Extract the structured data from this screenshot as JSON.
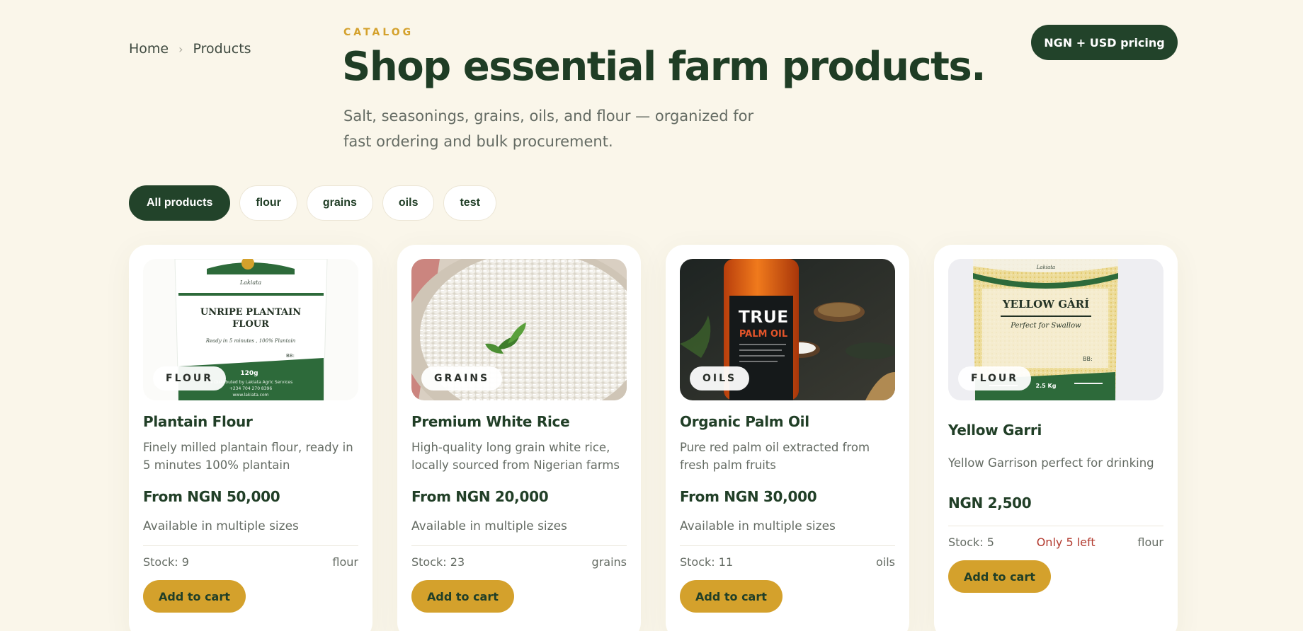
{
  "breadcrumb": {
    "home": "Home",
    "separator": "›",
    "current": "Products"
  },
  "header": {
    "eyebrow": "CATALOG",
    "title": "Shop essential farm products.",
    "subtitle": "Salt, seasonings, grains, oils, and flour — organized for fast ordering and bulk procurement.",
    "pricing_badge": "NGN + USD pricing"
  },
  "filters": [
    "All products",
    "flour",
    "grains",
    "oils",
    "test"
  ],
  "products": [
    {
      "category_badge": "FLOUR",
      "name": "Plantain Flour",
      "description": "Finely milled plantain flour, ready in 5 minutes 100% plantain",
      "price": "From NGN 50,000",
      "sizes": "Available in multiple sizes",
      "stock": "Stock: 9",
      "category": "flour",
      "add_label": "Add to cart",
      "image_text": {
        "brand": "Lakiata",
        "line1": "UNRIPE PLANTAIN",
        "line2": "FLOUR",
        "tagline": "Ready in 5 minutes , 100% Plantain",
        "bb": "BB:",
        "weight": "120g",
        "dist": "% Distributed by Lakiata Agric Services",
        "phone": "+234 704 270 8396",
        "web": "www.lakiata.com"
      }
    },
    {
      "category_badge": "GRAINS",
      "name": "Premium White Rice",
      "description": "High-quality long grain white rice, locally sourced from Nigerian farms",
      "price": "From NGN 20,000",
      "sizes": "Available in multiple sizes",
      "stock": "Stock: 23",
      "category": "grains",
      "add_label": "Add to cart"
    },
    {
      "category_badge": "OILS",
      "name": "Organic Palm Oil",
      "description": "Pure red palm oil extracted from fresh palm fruits",
      "price": "From NGN 30,000",
      "sizes": "Available in multiple sizes",
      "stock": "Stock: 11",
      "category": "oils",
      "add_label": "Add to cart",
      "image_text": {
        "line1": "TRUE",
        "line2": "PALM OIL"
      }
    },
    {
      "category_badge": "FLOUR",
      "name": "Yellow Garri",
      "description": "Yellow Garrison perfect for drinking",
      "price": "NGN 2,500",
      "sizes": "",
      "stock": "Stock: 5",
      "stock_warning": "Only 5 left",
      "category": "flour",
      "add_label": "Add to cart",
      "image_text": {
        "brand": "Lakiata",
        "line1": "YELLOW GÀRÍ",
        "tagline": "Perfect for Swallow",
        "bb": "BB:",
        "weight": "2.5 Kg"
      }
    }
  ],
  "colors": {
    "background": "#faf6ea",
    "primary_green": "#22432a",
    "accent_gold": "#d4a12c",
    "warning_red": "#b23a2e"
  }
}
